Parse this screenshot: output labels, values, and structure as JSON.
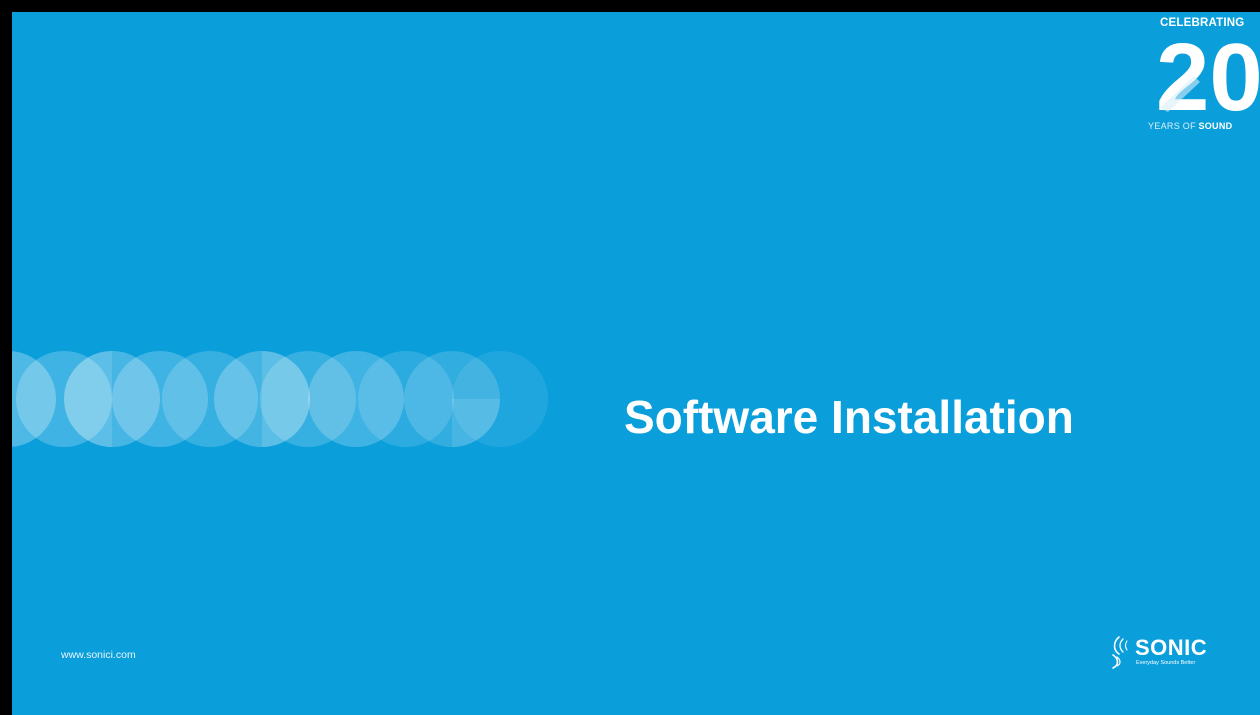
{
  "slide": {
    "title": "Software Installation",
    "website": "www.sonici.com",
    "background_color": "#0a9edb"
  },
  "badge": {
    "top_text": "CELEBRATING",
    "number": "20",
    "years_text": "YEARS OF",
    "sound_text": "SOUND"
  },
  "logo": {
    "icon": "sound-wave-icon",
    "wordmark": "SONIC",
    "tagline": "Everyday Sounds Better"
  }
}
